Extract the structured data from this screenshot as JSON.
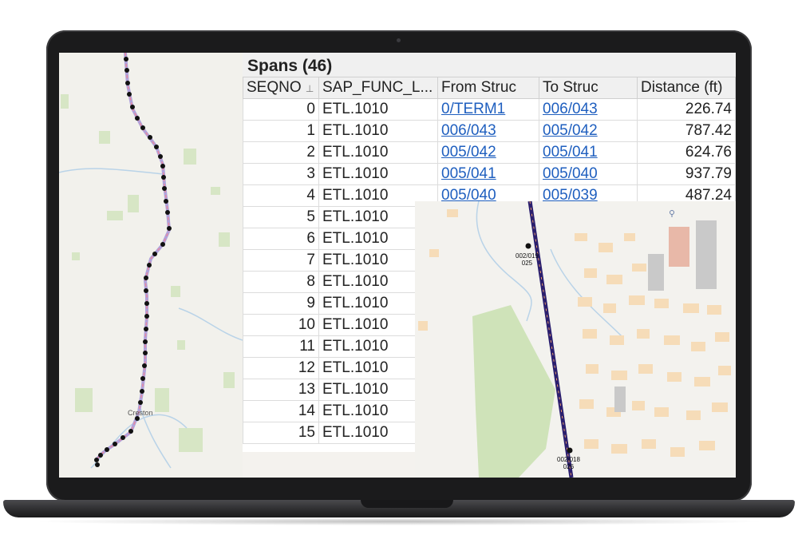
{
  "table": {
    "title": "Spans (46)",
    "columns": [
      "SEQNO",
      "SAP_FUNC_L...",
      "From Struc",
      "To Struc",
      "Distance (ft)"
    ],
    "sort_indicator": "⊥",
    "rows": [
      {
        "seq": "0",
        "func": "ETL.1010",
        "from": "0/TERM1",
        "to": "006/043",
        "dist": "226.74"
      },
      {
        "seq": "1",
        "func": "ETL.1010",
        "from": "006/043",
        "to": "005/042",
        "dist": "787.42"
      },
      {
        "seq": "2",
        "func": "ETL.1010",
        "from": "005/042",
        "to": "005/041",
        "dist": "624.76"
      },
      {
        "seq": "3",
        "func": "ETL.1010",
        "from": "005/041",
        "to": "005/040",
        "dist": "937.79"
      },
      {
        "seq": "4",
        "func": "ETL.1010",
        "from": "005/040",
        "to": "005/039",
        "dist": "487.24"
      },
      {
        "seq": "5",
        "func": "ETL.1010",
        "from": "",
        "to": "",
        "dist": ""
      },
      {
        "seq": "6",
        "func": "ETL.1010",
        "from": "",
        "to": "",
        "dist": ""
      },
      {
        "seq": "7",
        "func": "ETL.1010",
        "from": "",
        "to": "",
        "dist": ""
      },
      {
        "seq": "8",
        "func": "ETL.1010",
        "from": "",
        "to": "",
        "dist": ""
      },
      {
        "seq": "9",
        "func": "ETL.1010",
        "from": "",
        "to": "",
        "dist": ""
      },
      {
        "seq": "10",
        "func": "ETL.1010",
        "from": "",
        "to": "",
        "dist": ""
      },
      {
        "seq": "11",
        "func": "ETL.1010",
        "from": "",
        "to": "",
        "dist": ""
      },
      {
        "seq": "12",
        "func": "ETL.1010",
        "from": "",
        "to": "",
        "dist": ""
      },
      {
        "seq": "13",
        "func": "ETL.1010",
        "from": "",
        "to": "",
        "dist": ""
      },
      {
        "seq": "14",
        "func": "ETL.1010",
        "from": "",
        "to": "",
        "dist": ""
      },
      {
        "seq": "15",
        "func": "ETL.1010",
        "from": "",
        "to": "",
        "dist": ""
      }
    ]
  },
  "map_left": {
    "town_label": "Creston"
  },
  "map_right": {
    "node_top": {
      "line1": "002/019",
      "line2": "025"
    },
    "node_bottom": {
      "line1": "002/018",
      "line2": "026"
    }
  },
  "colors": {
    "link": "#1f5fbf",
    "route_line": "#2b1f6e",
    "node": "#111111",
    "park": "#cfe3b9",
    "building": "#f6dcb8"
  },
  "icons": [
    "map-pin-icon"
  ]
}
